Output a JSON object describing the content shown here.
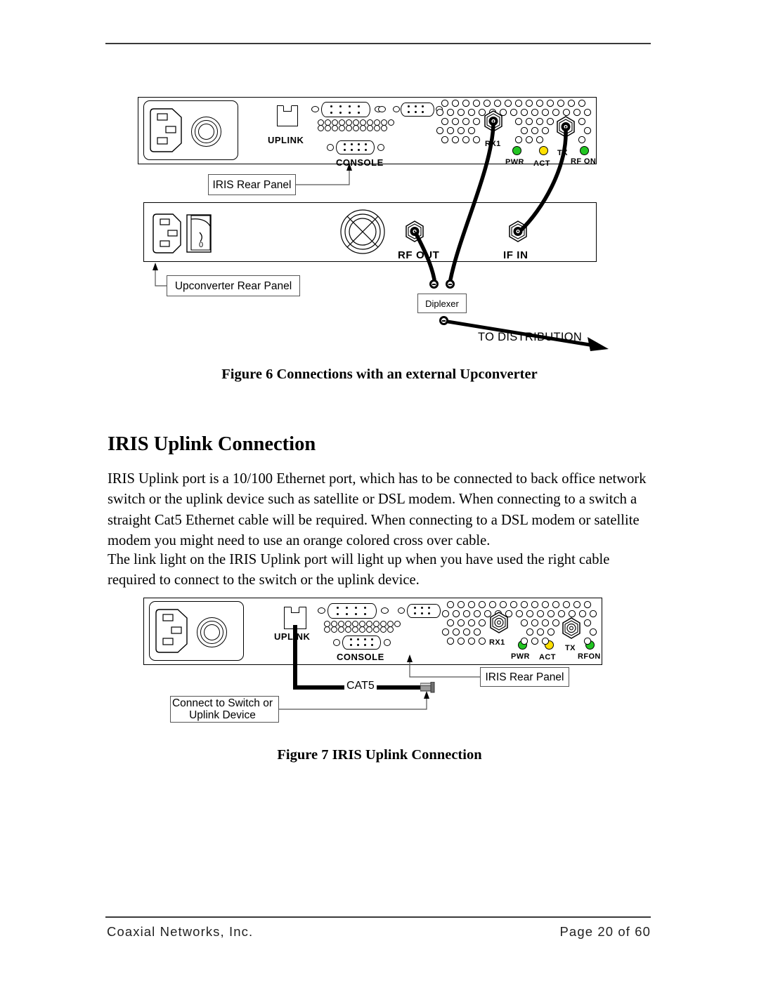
{
  "document": {
    "footer": {
      "company": "Coaxial Networks, Inc.",
      "page": "Page 20 of 60"
    },
    "section_heading": "IRIS Uplink Connection",
    "paragraphs": [
      "IRIS Uplink port is a 10/100 Ethernet port, which has to be connected to back office network switch or the uplink device such as satellite or DSL modem. When connecting to a switch a straight Cat5 Ethernet cable will be required. When connecting to a DSL modem or satellite modem you might need to use an orange colored cross over cable.",
      "The link light on the IRIS Uplink port will light up when you have used the right cable required to connect to the switch or the uplink device."
    ]
  },
  "figure6": {
    "caption": "Figure 6 Connections with an external Upconverter",
    "iris_panel": {
      "ports": {
        "uplink": "UPLINK",
        "console": "CONSOLE",
        "rx1": "RX1",
        "tx": "TX"
      },
      "leds": [
        {
          "label": "PWR",
          "color": "#22c522"
        },
        {
          "label": "ACT",
          "color": "#ffe000"
        },
        {
          "label": "RF ON",
          "color": "#22c522"
        }
      ]
    },
    "upconverter_panel": {
      "ports": {
        "rf_out": "RF OUT",
        "if_in": "IF IN"
      }
    },
    "callouts": {
      "iris_rear_panel": "IRIS Rear Panel",
      "upconverter_rear_panel": "Upconverter Rear Panel",
      "diplexer": "Diplexer"
    },
    "annotations": {
      "to_distribution": "TO DISTRIBUTION"
    }
  },
  "figure7": {
    "caption": "Figure 7 IRIS Uplink Connection",
    "iris_panel": {
      "ports": {
        "uplink": "UPLINK",
        "console": "CONSOLE",
        "rx1": "RX1",
        "tx": "TX"
      },
      "leds": [
        {
          "label": "PWR",
          "color": "#22c522"
        },
        {
          "label": "ACT",
          "color": "#ffe000"
        },
        {
          "label": "RFON",
          "color": "#22c522"
        }
      ]
    },
    "callouts": {
      "iris_rear_panel": "IRIS Rear Panel",
      "connect_to": "Connect to Switch or Uplink Device"
    },
    "annotations": {
      "cable": "CAT5"
    }
  }
}
